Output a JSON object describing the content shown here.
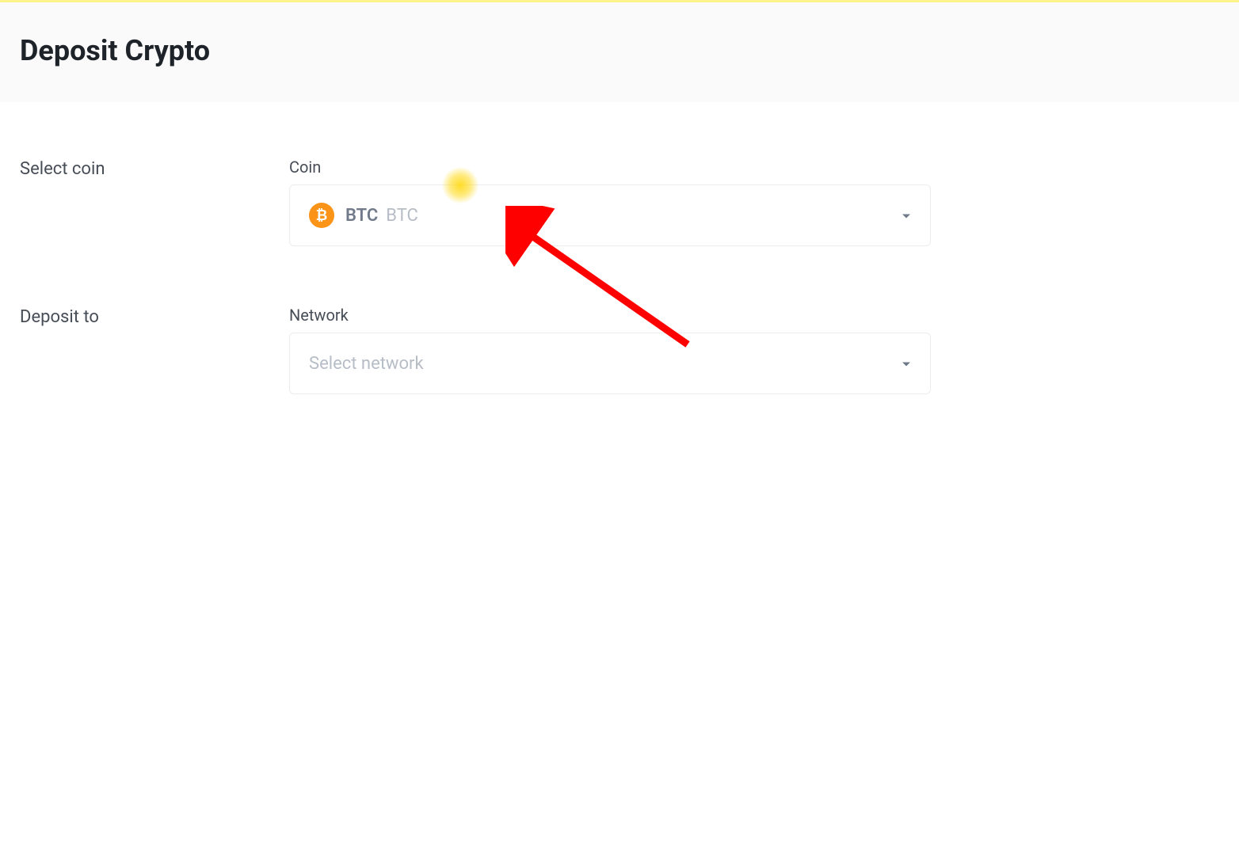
{
  "header": {
    "title": "Deposit Crypto"
  },
  "form": {
    "coin_section": {
      "label": "Select coin",
      "field_title": "Coin",
      "selected_coin_symbol": "BTC",
      "selected_coin_name": "BTC",
      "coin_icon_glyph": "₿"
    },
    "network_section": {
      "label": "Deposit to",
      "field_title": "Network",
      "placeholder": "Select network"
    }
  }
}
